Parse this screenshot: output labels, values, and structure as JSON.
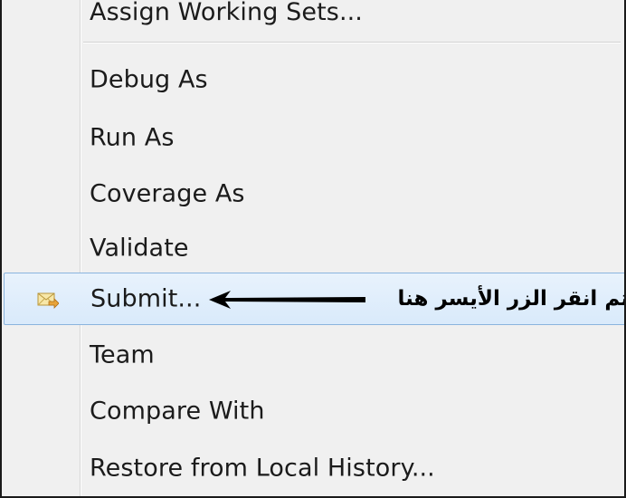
{
  "context_menu": {
    "items": [
      {
        "label": "Assign Working Sets..."
      },
      {
        "label": "Debug As"
      },
      {
        "label": "Run As"
      },
      {
        "label": "Coverage As"
      },
      {
        "label": "Validate"
      },
      {
        "label": "Submit...",
        "icon": "submit-envelope-icon",
        "selected": true
      },
      {
        "label": "Team"
      },
      {
        "label": "Compare With"
      },
      {
        "label": "Restore from Local History..."
      }
    ]
  },
  "annotation": {
    "text": "ثم انقر الزر الأيسر هنا",
    "arrow_direction": "left"
  },
  "colors": {
    "menu_background": "#f0f0f0",
    "selection_fill": "#dcebfb",
    "selection_border": "#8ab4de",
    "frame_border": "#1a1a1a",
    "text": "#1b1b1b"
  }
}
